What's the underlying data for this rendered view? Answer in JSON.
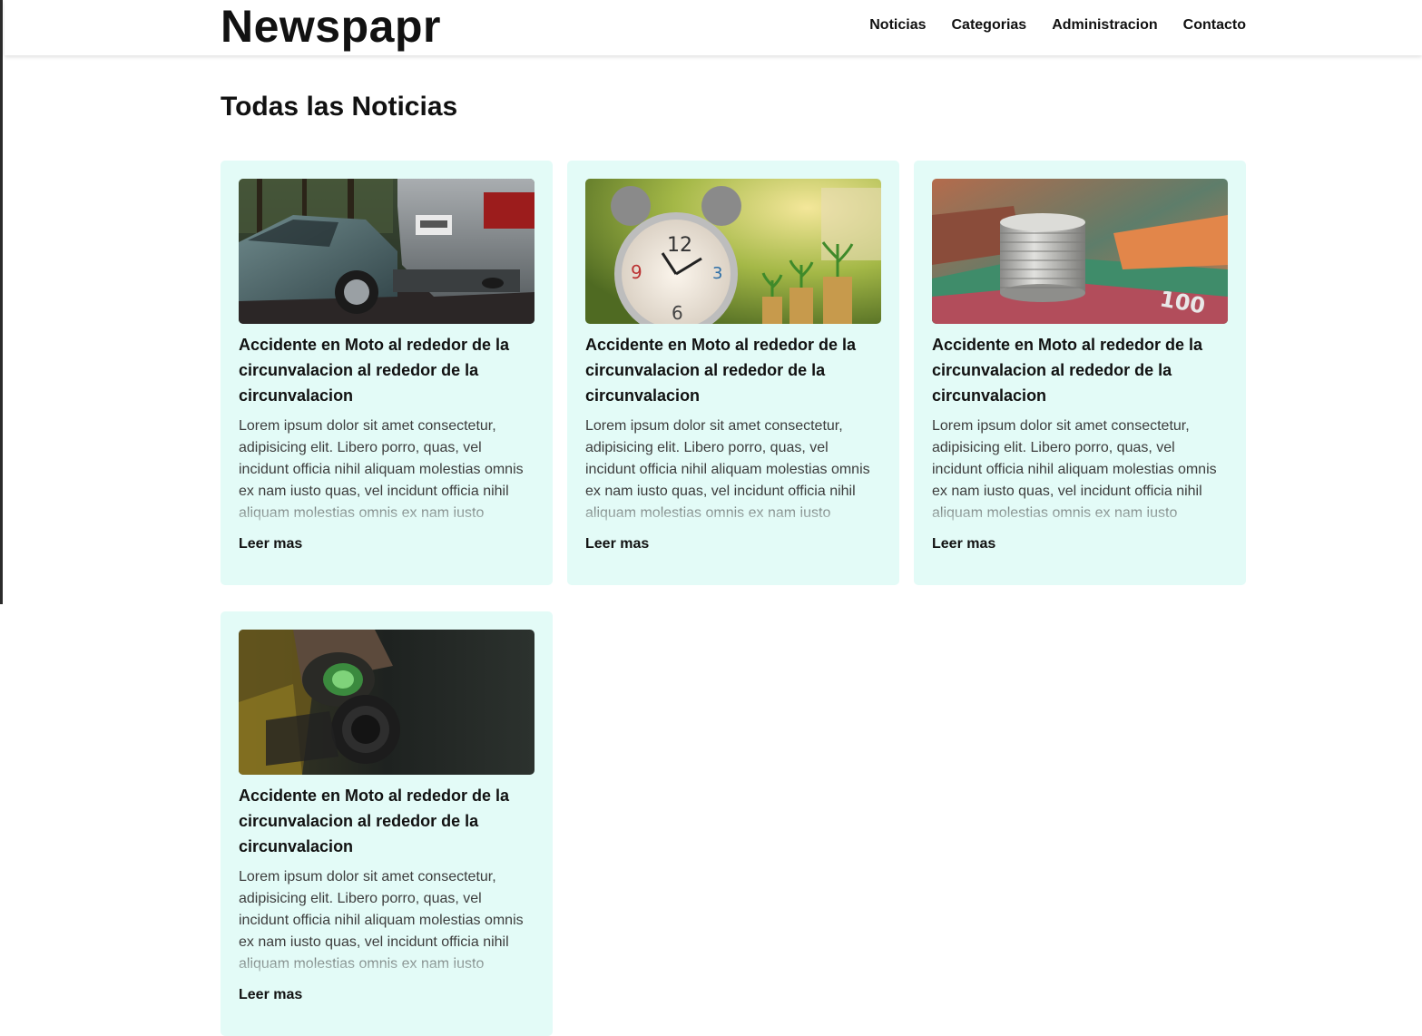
{
  "header": {
    "logo": "Newspapr",
    "nav": [
      "Noticias",
      "Categorias",
      "Administracion",
      "Contacto"
    ]
  },
  "main": {
    "title": "Todas las Noticias",
    "cards": [
      {
        "image": "car-crash-photo",
        "title": "Accidente en Moto al rededor de la circunvalacion al rededor de la circunvalacion",
        "text": "Lorem ipsum dolor sit amet consectetur, adipisicing elit. Libero porro, quas, vel incidunt officia nihil aliquam molestias omnis ex nam iusto quas, vel incidunt officia nihil aliquam molestias omnis ex nam iusto",
        "link": "Leer mas"
      },
      {
        "image": "alarm-clock-coins-photo",
        "title": "Accidente en Moto al rededor de la circunvalacion al rededor de la circunvalacion",
        "text": "Lorem ipsum dolor sit amet consectetur, adipisicing elit. Libero porro, quas, vel incidunt officia nihil aliquam molestias omnis ex nam iusto quas, vel incidunt officia nihil aliquam molestias omnis ex nam iusto",
        "link": "Leer mas"
      },
      {
        "image": "coins-banknotes-photo",
        "title": "Accidente en Moto al rededor de la circunvalacion al rededor de la circunvalacion",
        "text": "Lorem ipsum dolor sit amet consectetur, adipisicing elit. Libero porro, quas, vel incidunt officia nihil aliquam molestias omnis ex nam iusto quas, vel incidunt officia nihil aliquam molestias omnis ex nam iusto",
        "link": "Leer mas"
      },
      {
        "image": "gas-mask-photo",
        "title": "Accidente en Moto al rededor de la circunvalacion al rededor de la circunvalacion",
        "text": "Lorem ipsum dolor sit amet consectetur, adipisicing elit. Libero porro, quas, vel incidunt officia nihil aliquam molestias omnis ex nam iusto quas, vel incidunt officia nihil aliquam molestias omnis ex nam iusto",
        "link": "Leer mas"
      }
    ]
  },
  "colors": {
    "card_background": "#e3fbf7",
    "text": "#111111",
    "body_text": "#3d3d3d"
  }
}
